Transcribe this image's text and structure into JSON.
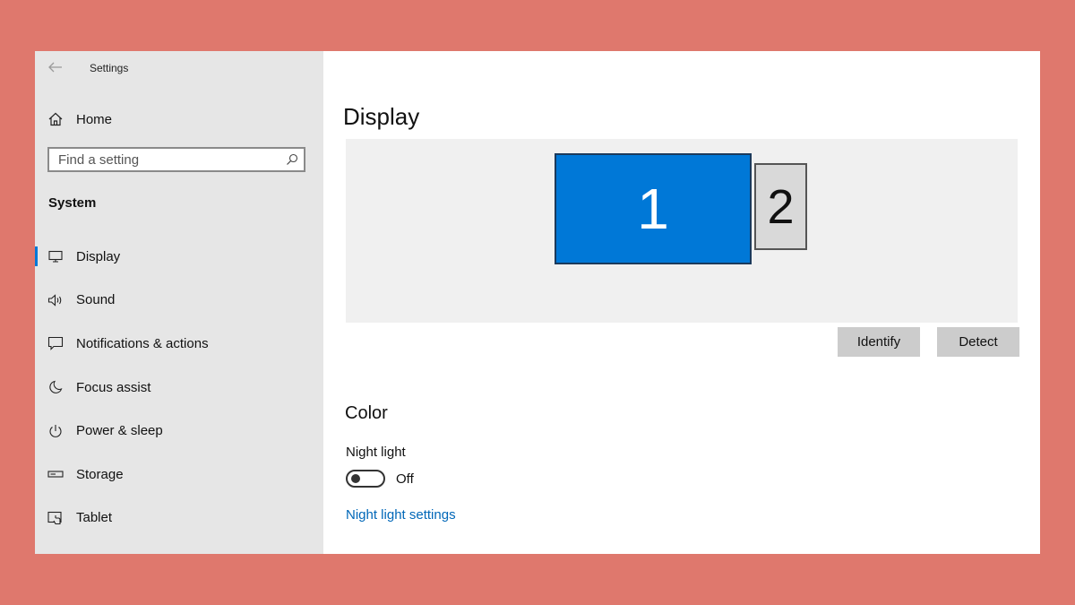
{
  "window": {
    "title": "Settings"
  },
  "sidebar": {
    "home_label": "Home",
    "search": {
      "placeholder": "Find a setting",
      "value": ""
    },
    "section_heading": "System",
    "items": [
      {
        "id": "display",
        "label": "Display",
        "icon": "monitor-icon",
        "active": true
      },
      {
        "id": "sound",
        "label": "Sound",
        "icon": "speaker-icon",
        "active": false
      },
      {
        "id": "notifications",
        "label": "Notifications & actions",
        "icon": "notification-icon",
        "active": false
      },
      {
        "id": "focus-assist",
        "label": "Focus assist",
        "icon": "moon-icon",
        "active": false
      },
      {
        "id": "power-sleep",
        "label": "Power & sleep",
        "icon": "power-icon",
        "active": false
      },
      {
        "id": "storage",
        "label": "Storage",
        "icon": "storage-icon",
        "active": false
      },
      {
        "id": "tablet",
        "label": "Tablet",
        "icon": "tablet-icon",
        "active": false
      }
    ]
  },
  "main": {
    "title": "Display",
    "monitors": [
      {
        "number": "1",
        "selected": true
      },
      {
        "number": "2",
        "selected": false
      }
    ],
    "buttons": {
      "identify": "Identify",
      "detect": "Detect"
    },
    "color_section": {
      "heading": "Color",
      "night_light_label": "Night light",
      "night_light_state": "Off",
      "night_light_on": false,
      "settings_link": "Night light settings"
    }
  },
  "colors": {
    "accent": "#0078d7",
    "link": "#0067b8",
    "sidebar_bg": "#e6e6e6",
    "page_bg": "#df786d"
  }
}
